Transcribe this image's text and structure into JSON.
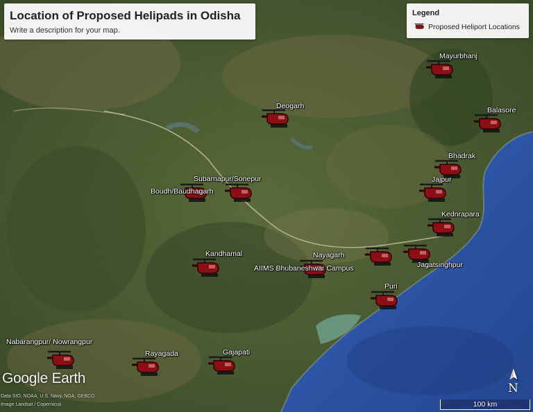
{
  "map": {
    "title": "Location of Proposed Helipads in Odisha",
    "description": "Write a description for your map."
  },
  "legend": {
    "title": "Legend",
    "item_label": "Proposed Heliport Locations",
    "item_icon": "helicopter-icon",
    "marker_color": "#8b0f14"
  },
  "places": [
    {
      "name": "Mayurbhanj"
    },
    {
      "name": "Balasore"
    },
    {
      "name": "Deogarh"
    },
    {
      "name": "Bhadrak"
    },
    {
      "name": "Jajpur"
    },
    {
      "name": "Subarnapur/Sonepur"
    },
    {
      "name": "Boudh/Baudhagarh"
    },
    {
      "name": "Kednrapara"
    },
    {
      "name": "Kandhamal"
    },
    {
      "name": "Nayagarh"
    },
    {
      "name": "AIIMS Bhubaneshwar Campus"
    },
    {
      "name": "Jagatsinghpur"
    },
    {
      "name": "Puri"
    },
    {
      "name": "Nabarangpur/ Nowrangpur"
    },
    {
      "name": "Rayagada"
    },
    {
      "name": "Gajapati"
    }
  ],
  "branding": {
    "logo": "Google Earth",
    "credit_line_1": "Data SIO, NOAA, U.S. Navy, NGA, GEBCO",
    "credit_line_2": "Image Landsat / Copernicus"
  },
  "compass": {
    "label": "N",
    "icon": "north-arrow-icon"
  },
  "scale_bar": {
    "label": "100 km"
  },
  "colors": {
    "land": "#4a5a33",
    "sea": "#2f56a8",
    "marker": "#8b0f14"
  }
}
